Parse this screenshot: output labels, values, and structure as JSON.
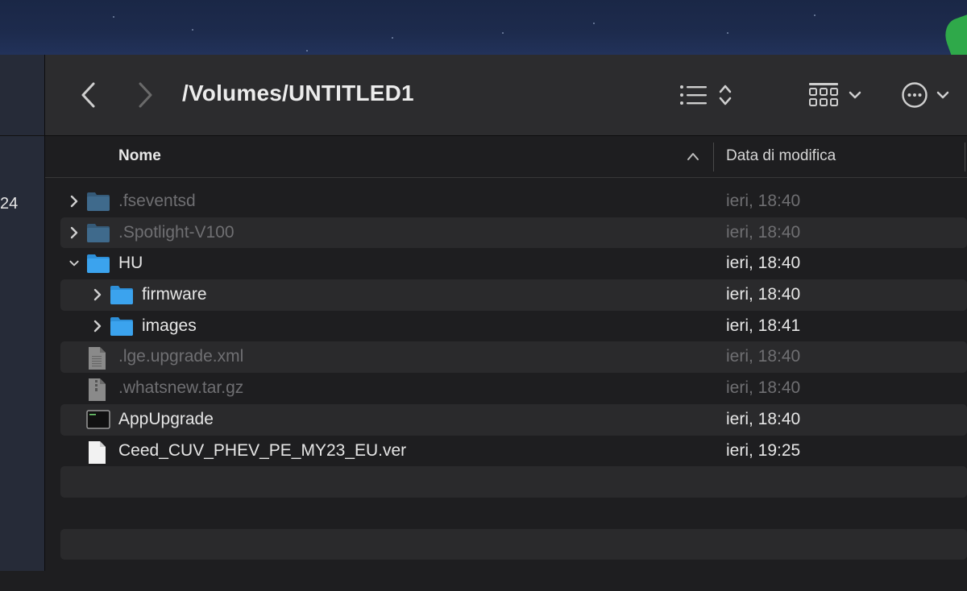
{
  "window": {
    "path_title": "/Volumes/UNTITLED1"
  },
  "sidebar": {
    "partial_label": "24"
  },
  "toolbar": {
    "back_icon": "chevron-left-icon",
    "forward_icon": "chevron-right-icon",
    "list_view_icon": "list-icon",
    "grid_view_icon": "grid-icon",
    "more_icon": "ellipsis-circle-icon"
  },
  "columns": {
    "name": "Nome",
    "date_modified": "Data di modifica",
    "sort_direction": "ascending"
  },
  "files": [
    {
      "name": ".fseventsd",
      "date": "ieri, 18:40",
      "kind": "folder",
      "level": 0,
      "expanded": false,
      "hidden": true
    },
    {
      "name": ".Spotlight-V100",
      "date": "ieri, 18:40",
      "kind": "folder",
      "level": 0,
      "expanded": false,
      "hidden": true
    },
    {
      "name": "HU",
      "date": "ieri, 18:40",
      "kind": "folder",
      "level": 0,
      "expanded": true,
      "hidden": false
    },
    {
      "name": "firmware",
      "date": "ieri, 18:40",
      "kind": "folder",
      "level": 1,
      "expanded": false,
      "hidden": false
    },
    {
      "name": "images",
      "date": "ieri, 18:41",
      "kind": "folder",
      "level": 1,
      "expanded": false,
      "hidden": false
    },
    {
      "name": ".lge.upgrade.xml",
      "date": "ieri, 18:40",
      "kind": "document",
      "level": 0,
      "hidden": true
    },
    {
      "name": ".whatsnew.tar.gz",
      "date": "ieri, 18:40",
      "kind": "archive",
      "level": 0,
      "hidden": true
    },
    {
      "name": "AppUpgrade",
      "date": "ieri, 18:40",
      "kind": "executable",
      "level": 0,
      "hidden": false
    },
    {
      "name": "Ceed_CUV_PHEV_PE_MY23_EU.ver",
      "date": "ieri, 19:25",
      "kind": "document",
      "level": 0,
      "hidden": false
    }
  ],
  "colors": {
    "folder_blue": "#3ba3ee",
    "folder_dim": "#3f6a8c",
    "toolbar_bg": "#2c2c2e",
    "row_alt_bg": "#2a2a2c",
    "window_bg": "#1e1e20"
  }
}
